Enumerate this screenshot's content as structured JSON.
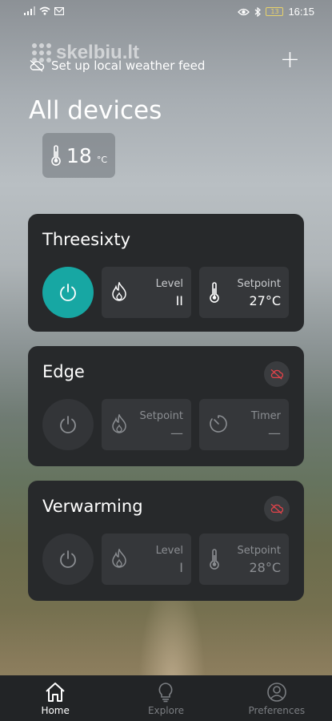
{
  "status_bar": {
    "time": "16:15",
    "battery": "13"
  },
  "watermark": {
    "text": "skelbiu.lt"
  },
  "header": {
    "weather_link": "Set up local weather feed",
    "add_button": "+",
    "title": "All devices"
  },
  "room_temperature": {
    "value": "18",
    "unit": "°C"
  },
  "devices": [
    {
      "name": "Threesixty",
      "power": "on",
      "offline": false,
      "tiles": [
        {
          "icon": "flame-icon",
          "label": "Level",
          "value": "II"
        },
        {
          "icon": "thermometer-icon",
          "label": "Setpoint",
          "value": "27°C"
        }
      ]
    },
    {
      "name": "Edge",
      "power": "off",
      "offline": true,
      "tiles": [
        {
          "icon": "flame-icon",
          "label": "Setpoint",
          "value": "—"
        },
        {
          "icon": "timer-icon",
          "label": "Timer",
          "value": "—"
        }
      ]
    },
    {
      "name": "Verwarming",
      "power": "off",
      "offline": true,
      "tiles": [
        {
          "icon": "flame-icon",
          "label": "Level",
          "value": "I"
        },
        {
          "icon": "thermometer-icon",
          "label": "Setpoint",
          "value": "28°C"
        }
      ]
    }
  ],
  "nav": {
    "home": "Home",
    "explore": "Explore",
    "preferences": "Preferences"
  },
  "colors": {
    "accent": "#17a7a3",
    "card": "#27292b",
    "tile": "#35373a",
    "offline": "#e0434a"
  }
}
